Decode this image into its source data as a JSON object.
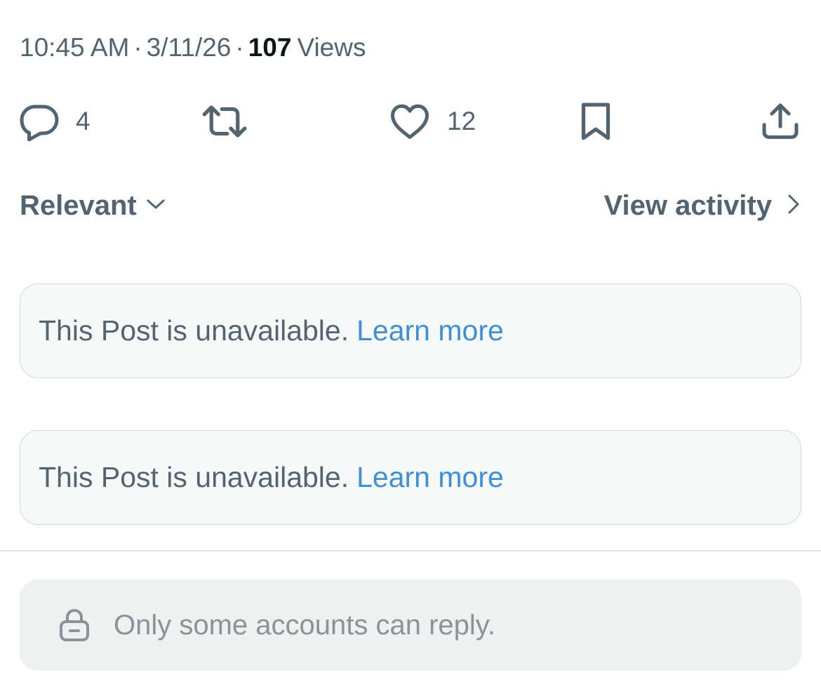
{
  "post_meta": {
    "time": "10:45 AM",
    "separator": "·",
    "date": "3/11/26",
    "views_count": "107",
    "views_label": "Views"
  },
  "actions": {
    "reply": {
      "icon": "reply-icon",
      "count": "4"
    },
    "repost": {
      "icon": "repost-icon"
    },
    "like": {
      "icon": "heart-icon",
      "count": "12"
    },
    "bookmark": {
      "icon": "bookmark-icon"
    },
    "share": {
      "icon": "share-icon"
    }
  },
  "replies_header": {
    "sort_label": "Relevant",
    "sort_icon": "chevron-down-icon",
    "view_activity_label": "View activity",
    "view_activity_icon": "chevron-right-icon"
  },
  "unavailable_posts": [
    {
      "text": "This Post is unavailable.",
      "link": "Learn more"
    },
    {
      "text": "This Post is unavailable.",
      "link": "Learn more"
    }
  ],
  "reply_restriction": {
    "icon": "lock-icon",
    "text": "Only some accounts can reply."
  },
  "colors": {
    "text_secondary": "#536471",
    "text_primary": "#0f1419",
    "link": "#3f8fd6",
    "card_background": "#f7f9f9",
    "card_border": "#cfd9de",
    "restriction_background": "#eff0f0",
    "restriction_text": "#8b9298"
  }
}
